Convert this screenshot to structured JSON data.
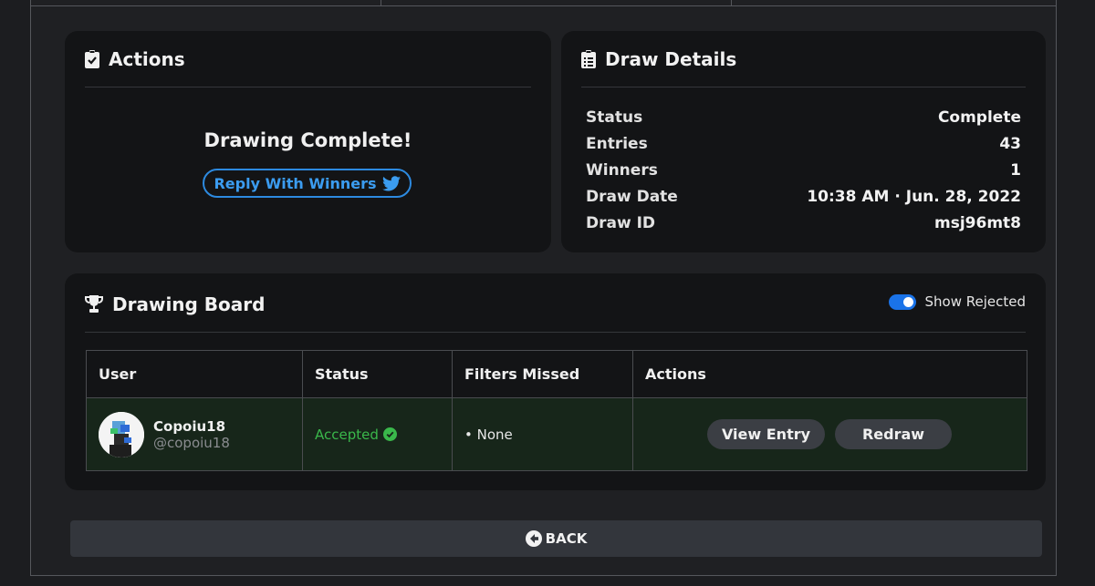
{
  "actions": {
    "title": "Actions",
    "complete_message": "Drawing Complete!",
    "reply_button_label": "Reply With Winners"
  },
  "details": {
    "title": "Draw Details",
    "rows": [
      {
        "key": "Status",
        "value": "Complete"
      },
      {
        "key": "Entries",
        "value": "43"
      },
      {
        "key": "Winners",
        "value": "1"
      },
      {
        "key": "Draw Date",
        "value": "10:38 AM · Jun. 28, 2022"
      },
      {
        "key": "Draw ID",
        "value": "msj96mt8"
      }
    ]
  },
  "board": {
    "title": "Drawing Board",
    "show_rejected_label": "Show Rejected",
    "show_rejected_on": true,
    "columns": [
      "User",
      "Status",
      "Filters Missed",
      "Actions"
    ],
    "rows": [
      {
        "name": "Copoiu18",
        "handle": "@copoiu18",
        "status": "Accepted",
        "filters_missed": "• None",
        "view_label": "View Entry",
        "redraw_label": "Redraw"
      }
    ]
  },
  "back_label": "BACK",
  "colors": {
    "accent_blue": "#2d8ae0",
    "accepted_green": "#3ab84b",
    "card_bg": "#131416",
    "row_bg": "#17261a"
  }
}
